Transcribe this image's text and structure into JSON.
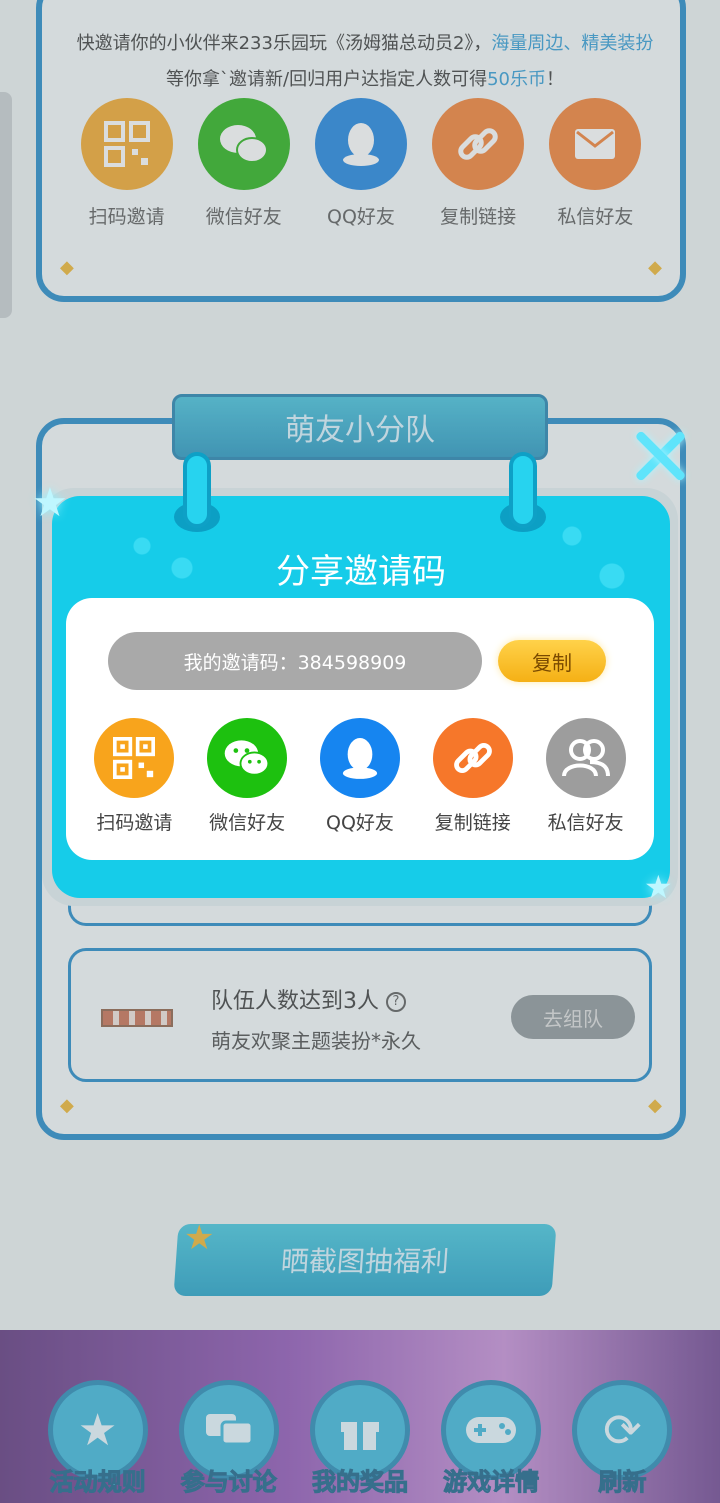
{
  "background": {
    "intro_part1": "快邀请你的小伙伴来233乐园玩《汤姆猫总动员2》，",
    "intro_hl1": "海量周边、精美装扮",
    "intro_part2": "等你拿`邀请新/回归用户达指定人数可得",
    "intro_hl2": "50乐币",
    "intro_part3": "！",
    "share_items": [
      {
        "label": "扫码邀请",
        "icon": "qr-code-icon",
        "color": "#f5a623"
      },
      {
        "label": "微信好友",
        "icon": "wechat-icon",
        "color": "#1fb20f"
      },
      {
        "label": "QQ好友",
        "icon": "qq-icon",
        "color": "#1681e0"
      },
      {
        "label": "复制链接",
        "icon": "link-icon",
        "color": "#f57c2c"
      },
      {
        "label": "私信好友",
        "icon": "mail-icon",
        "color": "#f57c2c"
      }
    ],
    "team_title": "萌友小分队",
    "task_title": "队伍人数达到3人",
    "task_reward": "萌友欢聚主题装扮*永久",
    "task_button": "去组队",
    "screenshot_banner": "晒截图抽福利",
    "bottom_nav": [
      {
        "label": "活动规则",
        "icon": "star-hand-icon"
      },
      {
        "label": "参与讨论",
        "icon": "chat-icon"
      },
      {
        "label": "我的奖品",
        "icon": "gift-icon"
      },
      {
        "label": "游戏详情",
        "icon": "gamepad-icon"
      },
      {
        "label": "刷新",
        "icon": "refresh-icon"
      }
    ]
  },
  "modal": {
    "title": "分享邀请码",
    "code_text": "我的邀请码：384598909",
    "copy_label": "复制",
    "share_items": [
      {
        "label": "扫码邀请",
        "icon": "qr-code-icon",
        "color": "#f8a41c"
      },
      {
        "label": "微信好友",
        "icon": "wechat-icon",
        "color": "#1dc10f"
      },
      {
        "label": "QQ好友",
        "icon": "qq-icon",
        "color": "#1685f0"
      },
      {
        "label": "复制链接",
        "icon": "link-icon",
        "color": "#f6772a"
      },
      {
        "label": "私信好友",
        "icon": "friends-icon",
        "color": "#9d9d9d"
      }
    ]
  }
}
